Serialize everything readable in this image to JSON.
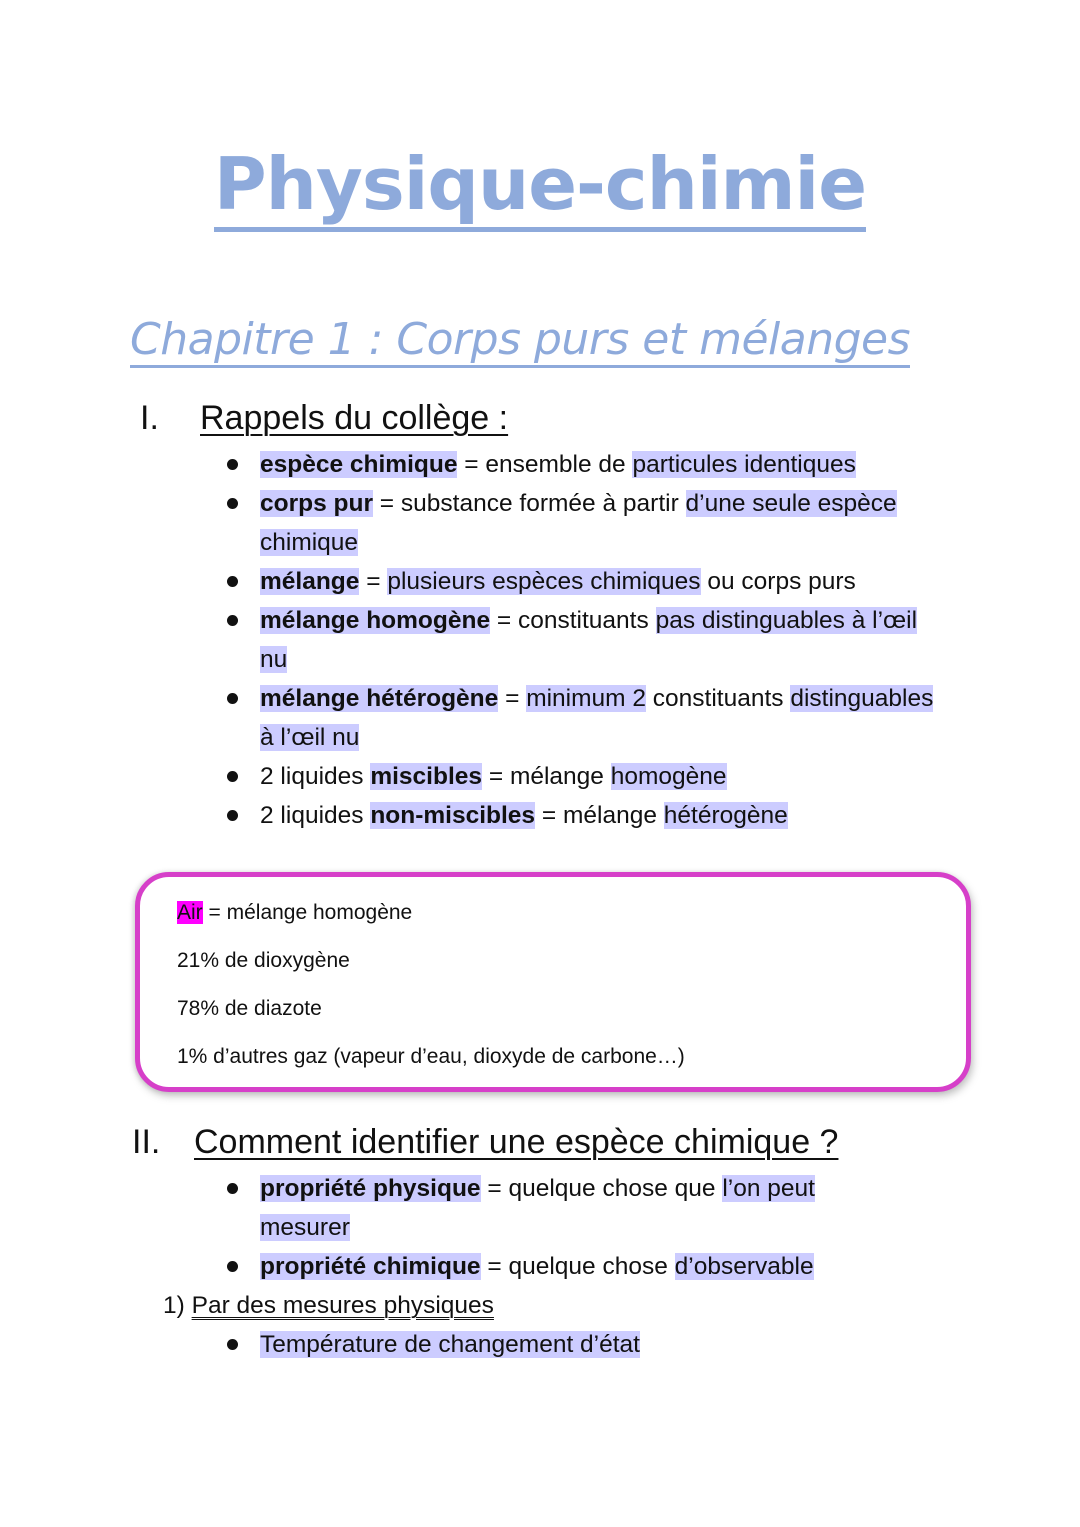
{
  "document": {
    "title": "Physique-chimie",
    "chapter": "Chapitre 1 : Corps purs et mélanges",
    "colors": {
      "heading_blue": "#8eaadb",
      "highlight_lavender": "#ccccff",
      "highlight_magenta": "#ff00ff",
      "box_border": "#d63fc9"
    }
  },
  "section1": {
    "number": "I.",
    "heading": "Rappels du collège :",
    "items": [
      {
        "term": "espèce chimique",
        "eq": " = ",
        "def_a": "ensemble de ",
        "def_b": "particules identiques"
      },
      {
        "term": "corps pur",
        "eq": " = ",
        "def_a": "substance formée à partir ",
        "def_b": "d’une seule espèce chimique"
      },
      {
        "term": "mélange",
        "eq": " = ",
        "def_a": "plusieurs espèces chimiques",
        "def_b": " ou corps purs"
      },
      {
        "term": "mélange homogène",
        "eq": " = ",
        "def_a": "constituants ",
        "def_b": "pas distinguables à l’œil nu"
      },
      {
        "term": "mélange hétérogène",
        "eq": " = ",
        "def_a": "minimum 2",
        "def_b": " constituants ",
        "def_c": "distinguables à l’œil nu"
      },
      {
        "prefix": "2 liquides ",
        "term": "miscibles",
        "eq": " = ",
        "def_a": "mélange ",
        "def_b": "homogène"
      },
      {
        "prefix": "2 liquides ",
        "term": "non-miscibles",
        "eq": " = ",
        "def_a": "mélange ",
        "def_b": "hétérogène"
      }
    ]
  },
  "air_box": {
    "term": "Air",
    "term_rest": " = mélange homogène",
    "lines": [
      "21% de dioxygène",
      "78% de diazote",
      "1% d’autres gaz (vapeur d’eau, dioxyde de carbone…)"
    ]
  },
  "section2": {
    "number": "II.",
    "heading": "Comment identifier une espèce chimique ?",
    "items": [
      {
        "term": "propriété physique",
        "eq": " = ",
        "def_a": "quelque chose que ",
        "def_b": "l’on peut mesurer"
      },
      {
        "term": "propriété chimique",
        "eq": " = ",
        "def_a": "quelque chose ",
        "def_b": "d’observable"
      }
    ],
    "subsection": {
      "number": "1)",
      "heading": "Par des mesures physiques",
      "items": [
        "Température de changement d’état"
      ]
    }
  }
}
